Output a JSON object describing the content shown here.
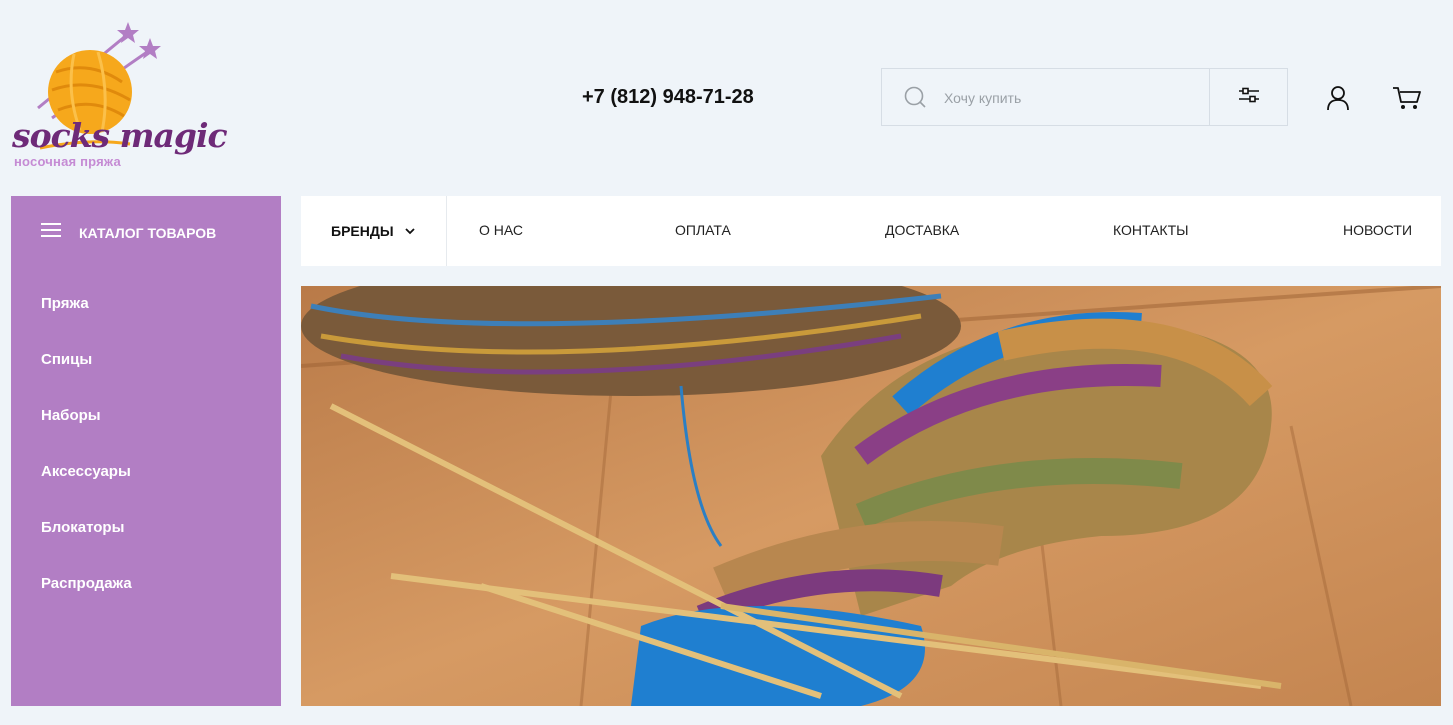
{
  "logo": {
    "brand": "socks magic",
    "tagline": "носочная пряжа"
  },
  "header": {
    "phone": "+7 (812) 948-71-28",
    "search": {
      "placeholder": "Хочу купить"
    }
  },
  "icons": {
    "search": "search-icon",
    "filter": "sliders-icon",
    "user": "user-icon",
    "cart": "cart-icon",
    "menu": "hamburger-icon",
    "chevron": "chevron-down-icon"
  },
  "catalog": {
    "title": "КАТАЛОГ ТОВАРОВ",
    "items": [
      "Пряжа",
      "Спицы",
      "Наборы",
      "Аксессуары",
      "Блокаторы",
      "Распродажа"
    ]
  },
  "nav": {
    "brands": "БРЕНДЫ",
    "items": [
      "О НАС",
      "ОПЛАТА",
      "ДОСТАВКА",
      "КОНТАКТЫ",
      "НОВОСТИ"
    ]
  },
  "colors": {
    "background": "#eff4f9",
    "catalog": "#b27ec4",
    "logo_text": "#6e2a78",
    "logo_sub": "#c58bd4"
  }
}
